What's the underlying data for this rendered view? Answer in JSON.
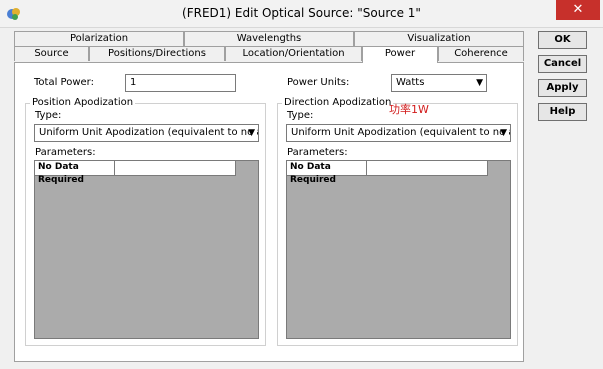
{
  "window": {
    "title": "(FRED1) Edit Optical Source: \"Source 1\"",
    "close_glyph": "✕"
  },
  "tabs_top": [
    "Polarization",
    "Wavelengths",
    "Visualization"
  ],
  "tabs_bottom": [
    "Source",
    "Positions/Directions",
    "Location/Orientation",
    "Power",
    "Coherence"
  ],
  "active_tab": "Power",
  "buttons": {
    "ok": "OK",
    "cancel": "Cancel",
    "apply": "Apply",
    "help": "Help"
  },
  "power": {
    "total_label": "Total Power:",
    "total_value": "1",
    "units_label": "Power Units:",
    "units_value": "Watts"
  },
  "position_apodization": {
    "title": "Position Apodization",
    "type_label": "Type:",
    "type_value": "Uniform Unit Apodization (equivalent to no ap",
    "params_label": "Parameters:",
    "grid_header": "No Data Required"
  },
  "direction_apodization": {
    "title": "Direction Apodization",
    "type_label": "Type:",
    "type_value": "Uniform Unit Apodization (equivalent to no ap",
    "params_label": "Parameters:",
    "grid_header": "No Data Required"
  },
  "annotation": "功率1W",
  "colors": {
    "close": "#c7302b",
    "annotation": "#d11a1a"
  },
  "icons": {
    "app": "fred-app-icon",
    "dropdown": "chevron-down-icon"
  }
}
